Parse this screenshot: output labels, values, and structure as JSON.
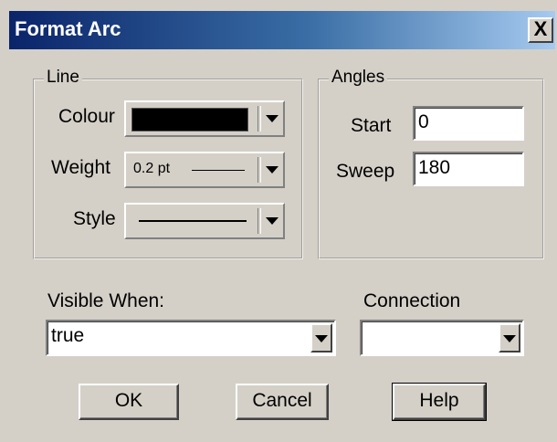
{
  "window": {
    "title": "Format Arc",
    "close_label": "X"
  },
  "line_group": {
    "legend": "Line",
    "colour_label": "Colour",
    "colour_value": "#000000",
    "weight_label": "Weight",
    "weight_value": "0.2 pt",
    "style_label": "Style"
  },
  "angles_group": {
    "legend": "Angles",
    "start_label": "Start",
    "start_value": "0",
    "sweep_label": "Sweep",
    "sweep_value": "180"
  },
  "visible_when": {
    "label": "Visible When:",
    "value": "true"
  },
  "connection": {
    "label": "Connection",
    "value": ""
  },
  "buttons": {
    "ok": "OK",
    "cancel": "Cancel",
    "help": "Help"
  },
  "icons": {
    "dropdown": "chevron-down-icon",
    "close": "close-icon"
  }
}
